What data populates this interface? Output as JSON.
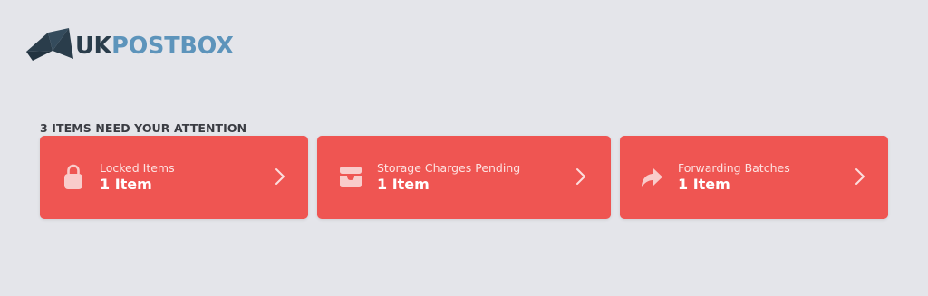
{
  "brand": {
    "part1": "UK",
    "part2": "POSTBOX",
    "icon": "postbox-logo-mark",
    "colors": {
      "dark": "#2a3d4b",
      "blue": "#5d94bb"
    }
  },
  "attention": {
    "heading": "3 ITEMS NEED YOUR ATTENTION",
    "accent_color": "#ef5552",
    "cards": [
      {
        "icon": "lock-icon",
        "label": "Locked Items",
        "count": "1 Item",
        "chevron": "chevron-right-icon"
      },
      {
        "icon": "inbox-tray-icon",
        "label": "Storage Charges Pending",
        "count": "1 Item",
        "chevron": "chevron-right-icon"
      },
      {
        "icon": "forward-arrow-icon",
        "label": "Forwarding Batches",
        "count": "1 Item",
        "chevron": "chevron-right-icon"
      }
    ]
  }
}
